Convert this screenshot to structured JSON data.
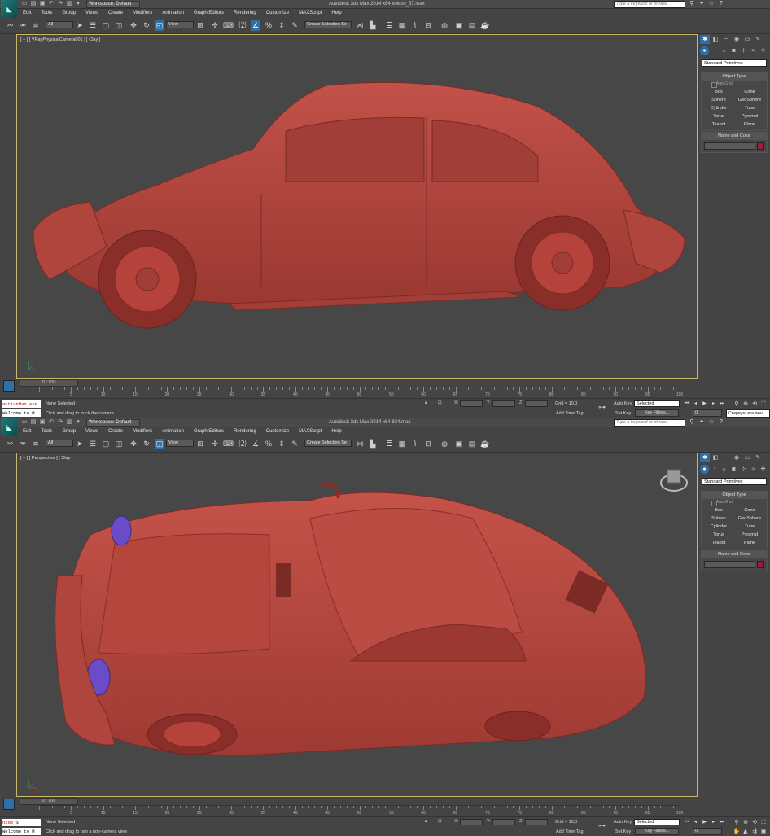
{
  "top": {
    "workspace": "Workspace: Default",
    "title": "Autodesk 3ds Max  2014 x64      koleso_37.max",
    "search_placeholder": "Type a keyword or phrase",
    "menu": [
      "Edit",
      "Tools",
      "Group",
      "Views",
      "Create",
      "Modifiers",
      "Animation",
      "Graph Editors",
      "Rendering",
      "Customize",
      "MAXScript",
      "Help"
    ],
    "selection_filter": "All",
    "ref_coord": "View",
    "named_selection": "Create Selection Se",
    "viewport_label": "[ + ] [ VRayPhysicalCamera001 ] [ Clay ]",
    "frame_slider": "0 / 100",
    "maxscript_line1": "actionMan.exe",
    "maxscript_line2": "Welcome to M",
    "status_line1": "None Selected",
    "status_line2": "Click and drag to truck the camera",
    "tooltip": "Свернуть все окна"
  },
  "bottom": {
    "workspace": "Workspace: Default",
    "title": "Autodesk 3ds Max  2014 x64      834.max",
    "search_placeholder": "Type a keyword or phrase",
    "menu": [
      "Edit",
      "Tools",
      "Group",
      "Views",
      "Create",
      "Modifiers",
      "Animation",
      "Graph Editors",
      "Rendering",
      "Customize",
      "MAXScript",
      "Help"
    ],
    "selection_filter": "All",
    "ref_coord": "View",
    "named_selection": "Create Selection Se",
    "viewport_label": "[ + ] [ Perspective ] [ Clay ]",
    "frame_slider": "0 / 100",
    "maxscript_line1": "hide $",
    "maxscript_line2": "Welcome to M",
    "status_line1": "None Selected",
    "status_line2": "Click and drag to pan a non-camera view"
  },
  "command_panel": {
    "primitive_dropdown": "Standard Primitives",
    "object_type_title": "Object Type",
    "autogrid": "AutoGrid",
    "buttons": [
      "Box",
      "Cone",
      "Sphere",
      "GeoSphere",
      "Cylinder",
      "Tube",
      "Torus",
      "Pyramid",
      "Teapot",
      "Plane"
    ],
    "name_color_title": "Name and Color",
    "object_color": "#9a1e3a"
  },
  "statusbar": {
    "x_label": "X:",
    "y_label": "Y:",
    "z_label": "Z:",
    "grid": "Grid = 10,0",
    "auto_key": "Auto Key",
    "set_key": "Set Key",
    "selected": "Selected",
    "key_filters": "Key Filters...",
    "add_time_tag": "Add Time Tag",
    "current_frame": "0"
  },
  "timeline_ticks": [
    "0",
    "5",
    "10",
    "15",
    "20",
    "25",
    "30",
    "35",
    "40",
    "45",
    "50",
    "55",
    "60",
    "65",
    "70",
    "75",
    "80",
    "85",
    "90",
    "95",
    "100"
  ],
  "colors": {
    "clay_body": "#b5433c",
    "clay_dark": "#8a2e29",
    "highlight_blue": "#2d6fa6",
    "viewport_bg": "#474747"
  }
}
